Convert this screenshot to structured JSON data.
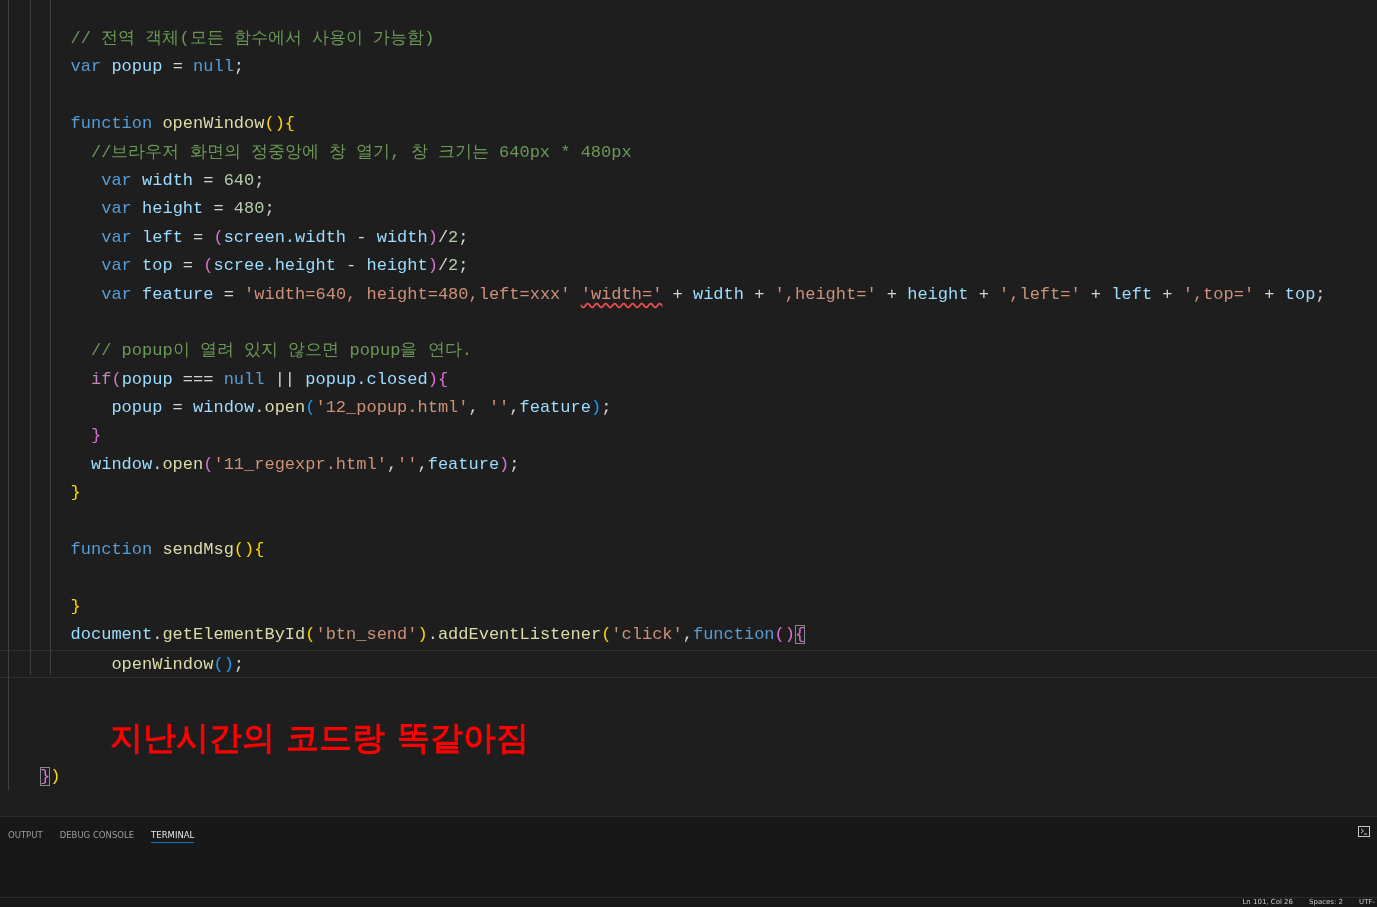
{
  "editor": {
    "lines": [
      {
        "kind": "code",
        "tokens": [
          {
            "kind": "comment",
            "text": "   // 전역 객체(모든 함수에서 사용이 가능함)"
          }
        ]
      },
      {
        "kind": "code",
        "tokens": [
          {
            "kind": "keyword",
            "text": "   var "
          },
          {
            "kind": "variable",
            "text": "popup"
          },
          {
            "kind": "plain",
            "text": " = "
          },
          {
            "kind": "keyword",
            "text": "null"
          },
          {
            "kind": "plain",
            "text": ";"
          }
        ]
      },
      {
        "kind": "blank"
      },
      {
        "kind": "code",
        "tokens": [
          {
            "kind": "keyword",
            "text": "   function "
          },
          {
            "kind": "function",
            "text": "openWindow"
          },
          {
            "kind": "bracket1",
            "text": "(){"
          }
        ]
      },
      {
        "kind": "code",
        "tokens": [
          {
            "kind": "comment",
            "text": "     //브라우저 화면의 정중앙에 창 열기, 창 크기는 640px * 480px"
          }
        ]
      },
      {
        "kind": "code",
        "tokens": [
          {
            "kind": "keyword",
            "text": "      var "
          },
          {
            "kind": "variable",
            "text": "width"
          },
          {
            "kind": "plain",
            "text": " = "
          },
          {
            "kind": "number",
            "text": "640"
          },
          {
            "kind": "plain",
            "text": ";"
          }
        ]
      },
      {
        "kind": "code",
        "tokens": [
          {
            "kind": "keyword",
            "text": "      var "
          },
          {
            "kind": "variable",
            "text": "height"
          },
          {
            "kind": "plain",
            "text": " = "
          },
          {
            "kind": "number",
            "text": "480"
          },
          {
            "kind": "plain",
            "text": ";"
          }
        ]
      },
      {
        "kind": "code",
        "tokens": [
          {
            "kind": "keyword",
            "text": "      var "
          },
          {
            "kind": "variable",
            "text": "left"
          },
          {
            "kind": "plain",
            "text": " = "
          },
          {
            "kind": "bracket2",
            "text": "("
          },
          {
            "kind": "variable",
            "text": "screen.width"
          },
          {
            "kind": "plain",
            "text": " - "
          },
          {
            "kind": "variable",
            "text": "width"
          },
          {
            "kind": "bracket2",
            "text": ")"
          },
          {
            "kind": "plain",
            "text": "/"
          },
          {
            "kind": "number",
            "text": "2"
          },
          {
            "kind": "plain",
            "text": ";"
          }
        ]
      },
      {
        "kind": "code",
        "tokens": [
          {
            "kind": "keyword",
            "text": "      var "
          },
          {
            "kind": "variable",
            "text": "top"
          },
          {
            "kind": "plain",
            "text": " = "
          },
          {
            "kind": "bracket2",
            "text": "("
          },
          {
            "kind": "variable",
            "text": "scree.height"
          },
          {
            "kind": "plain",
            "text": " - "
          },
          {
            "kind": "variable",
            "text": "height"
          },
          {
            "kind": "bracket2",
            "text": ")"
          },
          {
            "kind": "plain",
            "text": "/"
          },
          {
            "kind": "number",
            "text": "2"
          },
          {
            "kind": "plain",
            "text": ";"
          }
        ]
      },
      {
        "kind": "code",
        "tokens": [
          {
            "kind": "keyword",
            "text": "      var "
          },
          {
            "kind": "variable",
            "text": "feature"
          },
          {
            "kind": "plain",
            "text": " = "
          },
          {
            "kind": "string",
            "text": "'width=640, height=480,left=xxx' "
          },
          {
            "kind": "string",
            "text": "'width='",
            "squiggle": true
          },
          {
            "kind": "plain",
            "text": " + "
          },
          {
            "kind": "variable",
            "text": "width"
          },
          {
            "kind": "plain",
            "text": " + "
          },
          {
            "kind": "string",
            "text": "',height='"
          },
          {
            "kind": "plain",
            "text": " + "
          },
          {
            "kind": "variable",
            "text": "height"
          },
          {
            "kind": "plain",
            "text": " + "
          },
          {
            "kind": "string",
            "text": "',left='"
          },
          {
            "kind": "plain",
            "text": " + "
          },
          {
            "kind": "variable",
            "text": "left"
          },
          {
            "kind": "plain",
            "text": " + "
          },
          {
            "kind": "string",
            "text": "',top='"
          },
          {
            "kind": "plain",
            "text": " + "
          },
          {
            "kind": "variable",
            "text": "top"
          },
          {
            "kind": "plain",
            "text": ";"
          }
        ]
      },
      {
        "kind": "blank"
      },
      {
        "kind": "code",
        "tokens": [
          {
            "kind": "comment",
            "text": "     // popup이 열려 있지 않으면 popup을 연다."
          }
        ]
      },
      {
        "kind": "code",
        "tokens": [
          {
            "kind": "control",
            "text": "     if"
          },
          {
            "kind": "bracket2",
            "text": "("
          },
          {
            "kind": "variable",
            "text": "popup"
          },
          {
            "kind": "plain",
            "text": " === "
          },
          {
            "kind": "keyword",
            "text": "null"
          },
          {
            "kind": "plain",
            "text": " || "
          },
          {
            "kind": "variable",
            "text": "popup.closed"
          },
          {
            "kind": "bracket2",
            "text": "){"
          }
        ]
      },
      {
        "kind": "code",
        "tokens": [
          {
            "kind": "variable",
            "text": "       popup"
          },
          {
            "kind": "plain",
            "text": " = "
          },
          {
            "kind": "variable",
            "text": "window"
          },
          {
            "kind": "plain",
            "text": "."
          },
          {
            "kind": "function",
            "text": "open"
          },
          {
            "kind": "bracket3",
            "text": "("
          },
          {
            "kind": "string",
            "text": "'12_popup.html'"
          },
          {
            "kind": "plain",
            "text": ", "
          },
          {
            "kind": "string",
            "text": "''"
          },
          {
            "kind": "plain",
            "text": ","
          },
          {
            "kind": "variable",
            "text": "feature"
          },
          {
            "kind": "bracket3",
            "text": ")"
          },
          {
            "kind": "plain",
            "text": ";"
          }
        ]
      },
      {
        "kind": "code",
        "tokens": [
          {
            "kind": "bracket2",
            "text": "     }"
          }
        ]
      },
      {
        "kind": "code",
        "tokens": [
          {
            "kind": "variable",
            "text": "     window"
          },
          {
            "kind": "plain",
            "text": "."
          },
          {
            "kind": "function",
            "text": "open"
          },
          {
            "kind": "bracket2",
            "text": "("
          },
          {
            "kind": "string",
            "text": "'11_regexpr.html'"
          },
          {
            "kind": "plain",
            "text": ","
          },
          {
            "kind": "string",
            "text": "''"
          },
          {
            "kind": "plain",
            "text": ","
          },
          {
            "kind": "variable",
            "text": "feature"
          },
          {
            "kind": "bracket2",
            "text": ")"
          },
          {
            "kind": "plain",
            "text": ";"
          }
        ]
      },
      {
        "kind": "code",
        "tokens": [
          {
            "kind": "bracket1",
            "text": "   }"
          }
        ]
      },
      {
        "kind": "blank"
      },
      {
        "kind": "code",
        "tokens": [
          {
            "kind": "keyword",
            "text": "   function "
          },
          {
            "kind": "function",
            "text": "sendMsg"
          },
          {
            "kind": "bracket1",
            "text": "(){"
          }
        ]
      },
      {
        "kind": "blank"
      },
      {
        "kind": "code",
        "tokens": [
          {
            "kind": "bracket1",
            "text": "   }"
          }
        ]
      },
      {
        "kind": "code",
        "tokens": [
          {
            "kind": "variable",
            "text": "   document"
          },
          {
            "kind": "plain",
            "text": "."
          },
          {
            "kind": "function",
            "text": "getElementById"
          },
          {
            "kind": "bracket1",
            "text": "("
          },
          {
            "kind": "string",
            "text": "'btn_send'"
          },
          {
            "kind": "bracket1",
            "text": ")"
          },
          {
            "kind": "plain",
            "text": "."
          },
          {
            "kind": "function",
            "text": "addEventListener"
          },
          {
            "kind": "bracket1",
            "text": "("
          },
          {
            "kind": "string",
            "text": "'click'"
          },
          {
            "kind": "plain",
            "text": ","
          },
          {
            "kind": "keyword",
            "text": "function"
          },
          {
            "kind": "bracket2",
            "text": "()"
          },
          {
            "kind": "bracket2",
            "text": "{",
            "matched": true
          }
        ]
      },
      {
        "kind": "code",
        "current": true,
        "tokens": [
          {
            "kind": "function",
            "text": "       openWindow"
          },
          {
            "kind": "bracket3",
            "text": "()"
          },
          {
            "kind": "plain",
            "text": ";"
          }
        ]
      },
      {
        "kind": "blank"
      },
      {
        "kind": "blank"
      },
      {
        "kind": "blank"
      },
      {
        "kind": "code",
        "tokens": [
          {
            "kind": "bracket2",
            "text": "}",
            "matched": true
          },
          {
            "kind": "bracket1",
            "text": ")"
          }
        ]
      }
    ],
    "annotation": "지난시간의 코드랑 똑같아짐"
  },
  "panel": {
    "tabs": [
      {
        "label": "OUTPUT",
        "selected": false
      },
      {
        "label": "DEBUG CONSOLE",
        "selected": false
      },
      {
        "label": "TERMINAL",
        "selected": true
      }
    ]
  },
  "status_bar": [
    "Ln 101, Col 26",
    "Spaces: 2",
    "UTF-"
  ]
}
